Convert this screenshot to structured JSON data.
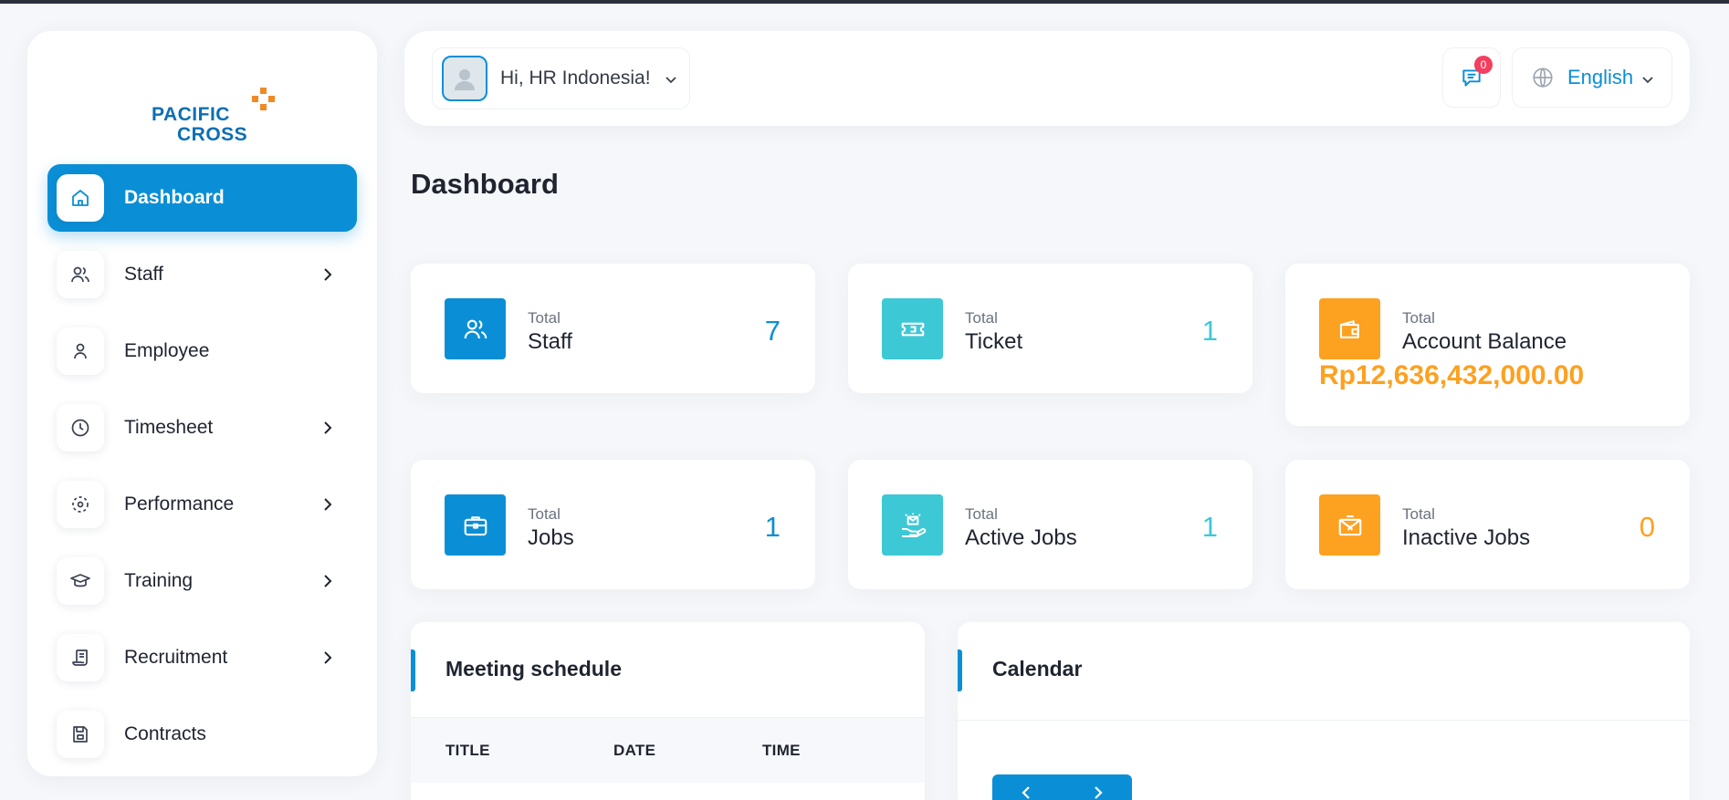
{
  "brand": {
    "line1": "PACIFIC",
    "line2": "CROSS",
    "colors": {
      "blue": "#0c6fb3",
      "orange": "#f08a24"
    }
  },
  "sidebar": {
    "items": [
      {
        "label": "Dashboard",
        "icon": "home-icon",
        "active": true,
        "has_submenu": false
      },
      {
        "label": "Staff",
        "icon": "users-icon",
        "has_submenu": true
      },
      {
        "label": "Employee",
        "icon": "user-icon",
        "has_submenu": false
      },
      {
        "label": "Timesheet",
        "icon": "clock-icon",
        "has_submenu": true
      },
      {
        "label": "Performance",
        "icon": "target-icon",
        "has_submenu": true
      },
      {
        "label": "Training",
        "icon": "graduation-cap-icon",
        "has_submenu": true
      },
      {
        "label": "Recruitment",
        "icon": "scroll-icon",
        "has_submenu": true
      },
      {
        "label": "Contracts",
        "icon": "save-icon",
        "has_submenu": false
      }
    ]
  },
  "header": {
    "greeting": "Hi, HR Indonesia!",
    "notifications_count": "0",
    "language": "English"
  },
  "page": {
    "title": "Dashboard"
  },
  "stats": [
    {
      "small": "Total",
      "label": "Staff",
      "value": "7",
      "color": "#0a8fd6",
      "icon": "users-icon"
    },
    {
      "small": "Total",
      "label": "Ticket",
      "value": "1",
      "color": "#3dc8d5",
      "icon": "ticket-icon"
    },
    {
      "small": "Total",
      "label": "Account Balance",
      "value": "Rp12,636,432,000.00",
      "color": "#fda120",
      "icon": "wallet-icon"
    },
    {
      "small": "Total",
      "label": "Jobs",
      "value": "1",
      "color": "#0a8fd6",
      "icon": "briefcase-icon"
    },
    {
      "small": "Total",
      "label": "Active Jobs",
      "value": "1",
      "color": "#3dc8d5",
      "icon": "hand-envelope-icon"
    },
    {
      "small": "Total",
      "label": "Inactive Jobs",
      "value": "0",
      "color": "#fda120",
      "icon": "closed-envelope-icon"
    }
  ],
  "meeting": {
    "title": "Meeting schedule",
    "columns": [
      "TITLE",
      "DATE",
      "TIME"
    ]
  },
  "calendar": {
    "title": "Calendar"
  }
}
